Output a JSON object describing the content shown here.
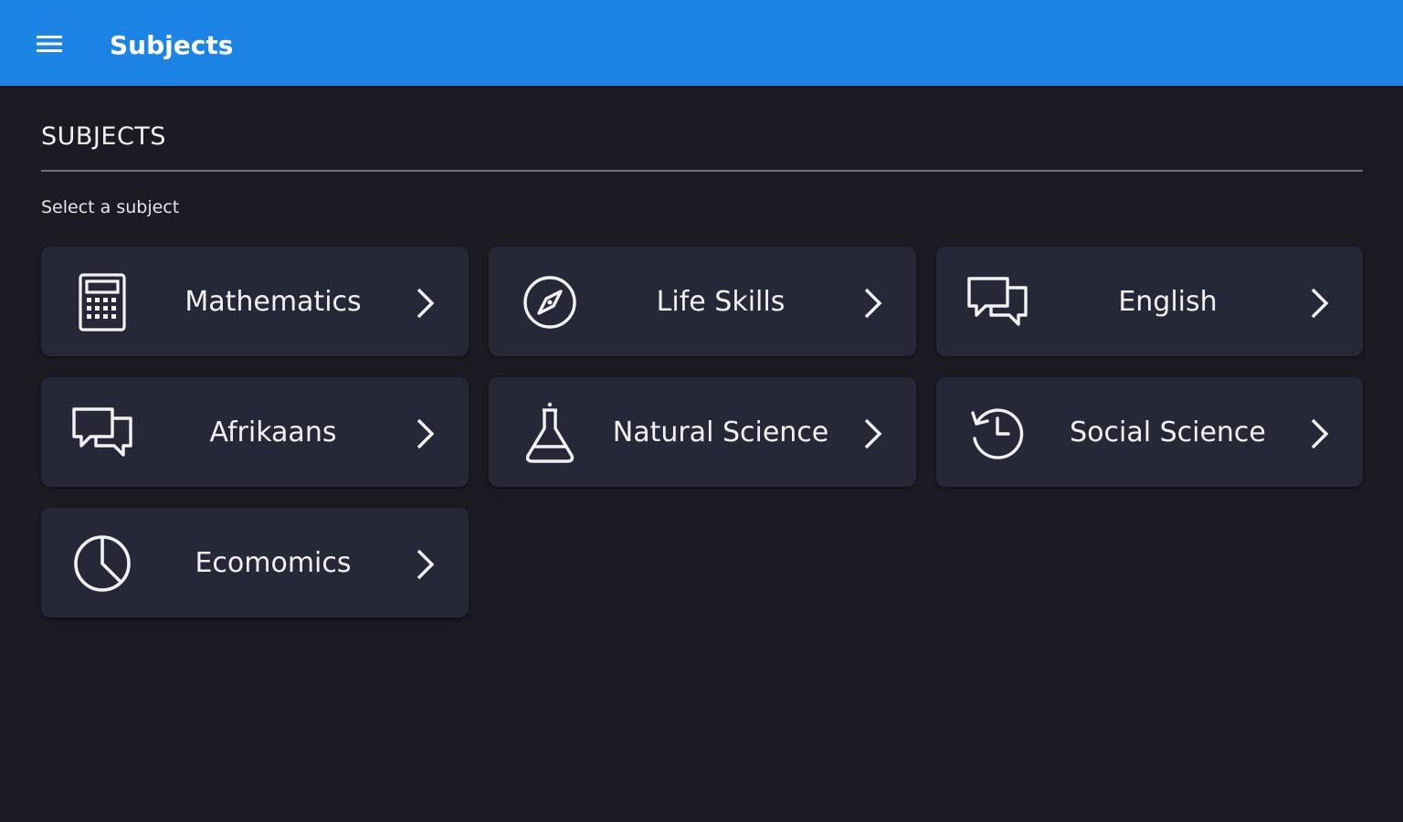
{
  "appbar": {
    "title": "Subjects",
    "menu_icon": "hamburger-menu-icon",
    "color": "#1c84e4"
  },
  "page": {
    "section_title": "SUBJECTS",
    "subtitle": "Select a subject"
  },
  "subjects": [
    {
      "label": "Mathematics",
      "icon": "calculator-icon"
    },
    {
      "label": "Life Skills",
      "icon": "compass-icon"
    },
    {
      "label": "English",
      "icon": "chat-bubbles-icon"
    },
    {
      "label": "Afrikaans",
      "icon": "chat-bubbles-icon"
    },
    {
      "label": "Natural Science",
      "icon": "flask-icon"
    },
    {
      "label": "Social Science",
      "icon": "history-clock-icon"
    },
    {
      "label": "Ecomomics",
      "icon": "pie-chart-icon"
    }
  ],
  "colors": {
    "background": "#1b1b23",
    "card": "#262838",
    "text": "#f2f2f5"
  }
}
